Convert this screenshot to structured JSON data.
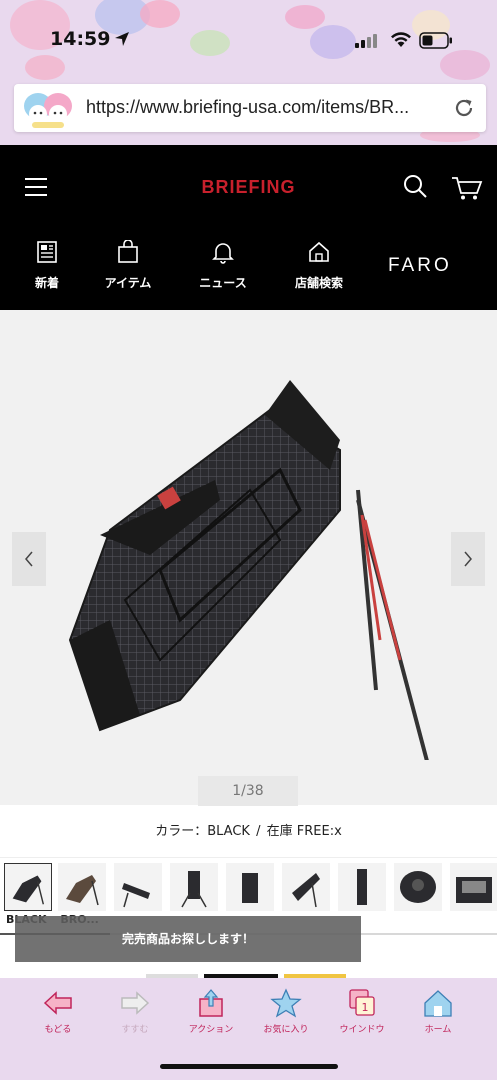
{
  "status_bar": {
    "time": "14:59"
  },
  "browser": {
    "url": "https://www.briefing-usa.com/items/BR..."
  },
  "site_header": {
    "brand": "BRIEFING",
    "nav": [
      {
        "label": "新着",
        "icon": "news-paper-icon"
      },
      {
        "label": "アイテム",
        "icon": "shopping-bag-icon"
      },
      {
        "label": "ニュース",
        "icon": "bell-icon"
      },
      {
        "label": "店舗検索",
        "icon": "store-icon"
      }
    ],
    "faro": "FARO"
  },
  "product": {
    "pager": "1/38",
    "color_label": "カラー：BLACK",
    "separator": "/",
    "stock_label": "在庫 FREE:x",
    "thumb_labels": [
      "BLACK",
      "BRO..."
    ],
    "toast": "完売商品お探しします！",
    "swatch_colors": [
      "#dddddd",
      "#111111",
      "#f0c542"
    ]
  },
  "toolbar": {
    "items": [
      {
        "label": "もどる",
        "icon": "back-arrow-icon",
        "enabled": true
      },
      {
        "label": "すすむ",
        "icon": "forward-arrow-icon",
        "enabled": false
      },
      {
        "label": "アクション",
        "icon": "share-icon",
        "enabled": true
      },
      {
        "label": "お気に入り",
        "icon": "star-icon",
        "enabled": true
      },
      {
        "label": "ウインドウ",
        "icon": "windows-icon",
        "enabled": true
      },
      {
        "label": "ホーム",
        "icon": "home-icon",
        "enabled": true
      }
    ],
    "window_count": "1"
  },
  "colors": {
    "brand_red": "#c8202c",
    "toolbar_pink": "#c0245a",
    "header_bg": "#000000"
  }
}
